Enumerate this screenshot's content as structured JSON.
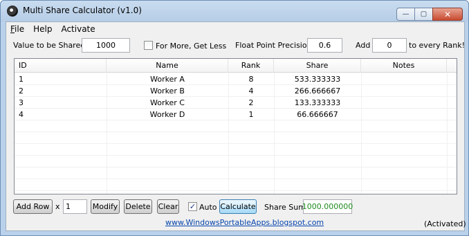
{
  "window": {
    "title": "Multi Share Calculator (v1.0)",
    "controls": {
      "minimize": "—",
      "maximize": "▢",
      "close": "✕"
    }
  },
  "menu": [
    {
      "label_prefix": "F",
      "label_rest": "ile"
    },
    {
      "label_prefix": "",
      "label_rest": "Help"
    },
    {
      "label_prefix": "",
      "label_rest": "Activate"
    }
  ],
  "top_controls": {
    "value_label": "Value to be Shared:",
    "value": "1000",
    "for_more_label": "For More, Get Less",
    "for_more_checked": false,
    "precision_label": "Float Point Precision:",
    "precision": "0.6",
    "add_label": "Add",
    "add_value": "0",
    "add_suffix": "to every Rank!"
  },
  "table": {
    "columns": [
      "ID",
      "Name",
      "Rank",
      "Share",
      "Notes"
    ],
    "rows": [
      {
        "id": "1",
        "name": "Worker A",
        "rank": "8",
        "share": "533.333333",
        "notes": ""
      },
      {
        "id": "2",
        "name": "Worker B",
        "rank": "4",
        "share": "266.666667",
        "notes": ""
      },
      {
        "id": "3",
        "name": "Worker C",
        "rank": "2",
        "share": "133.333333",
        "notes": ""
      },
      {
        "id": "4",
        "name": "Worker D",
        "rank": "1",
        "share": "66.666667",
        "notes": ""
      }
    ]
  },
  "bottom_controls": {
    "add_row": "Add Row",
    "x_label": "x",
    "count": "1",
    "modify": "Modify",
    "delete": "Delete",
    "clear": "Clear",
    "auto_label": "Auto",
    "auto_checked": true,
    "calculate": "Calculate",
    "share_sum_label": "Share Sum",
    "share_sum": "1000.000000"
  },
  "footer": {
    "link": "www.WindowsPortableApps.blogspot.com",
    "status": "(Activated)"
  },
  "colors": {
    "sum_text": "#1e8a1e",
    "link": "#0645ad",
    "close_button": "#c84a30"
  }
}
